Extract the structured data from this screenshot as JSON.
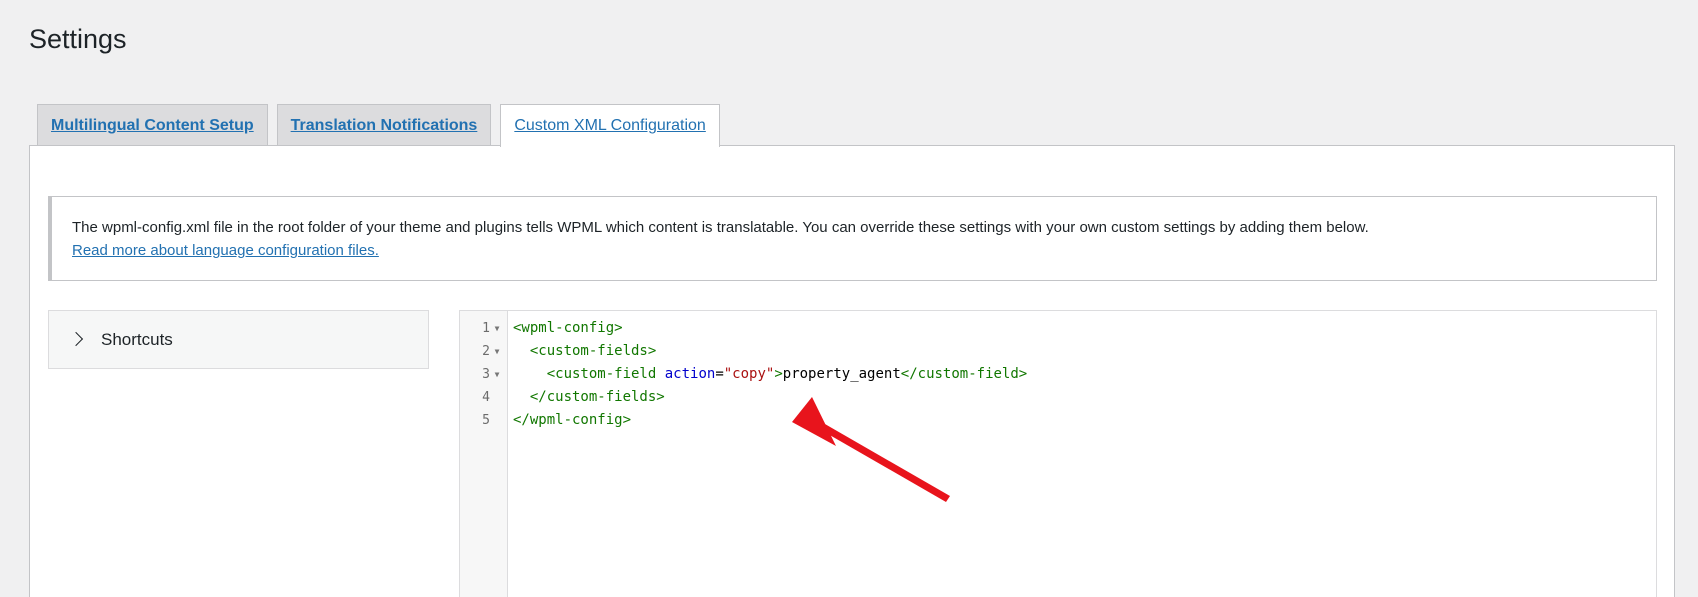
{
  "page": {
    "title": "Settings"
  },
  "tabs": [
    {
      "label": "Multilingual Content Setup",
      "active": false
    },
    {
      "label": "Translation Notifications",
      "active": false
    },
    {
      "label": "Custom XML Configuration",
      "active": true
    }
  ],
  "notice": {
    "text": "The wpml-config.xml file in the root folder of your theme and plugins tells WPML which content is translatable. You can override these settings with your own custom settings by adding them below.",
    "link_label": "Read more about language configuration files."
  },
  "shortcuts": {
    "label": "Shortcuts",
    "icon": "chevron-right-icon"
  },
  "editor": {
    "line_numbers": [
      "1",
      "2",
      "3",
      "4",
      "5"
    ],
    "lines": [
      {
        "indent": "",
        "open_tag": "<wpml-config>"
      },
      {
        "indent": "  ",
        "open_tag": "<custom-fields>"
      },
      {
        "indent": "    ",
        "tag_start": "<custom-field ",
        "attr_name": "action",
        "equals": "=",
        "attr_value": "\"copy\"",
        "tag_close": ">",
        "content": "property_agent",
        "close_tag": "</custom-field>"
      },
      {
        "indent": "  ",
        "open_tag": "</custom-fields>"
      },
      {
        "indent": "",
        "open_tag": "</wpml-config>"
      }
    ]
  },
  "colors": {
    "link": "#2271b1",
    "xml_tag": "#117700",
    "xml_attr": "#0000cc",
    "xml_string": "#aa1111",
    "annotation_arrow": "#e8141c"
  }
}
